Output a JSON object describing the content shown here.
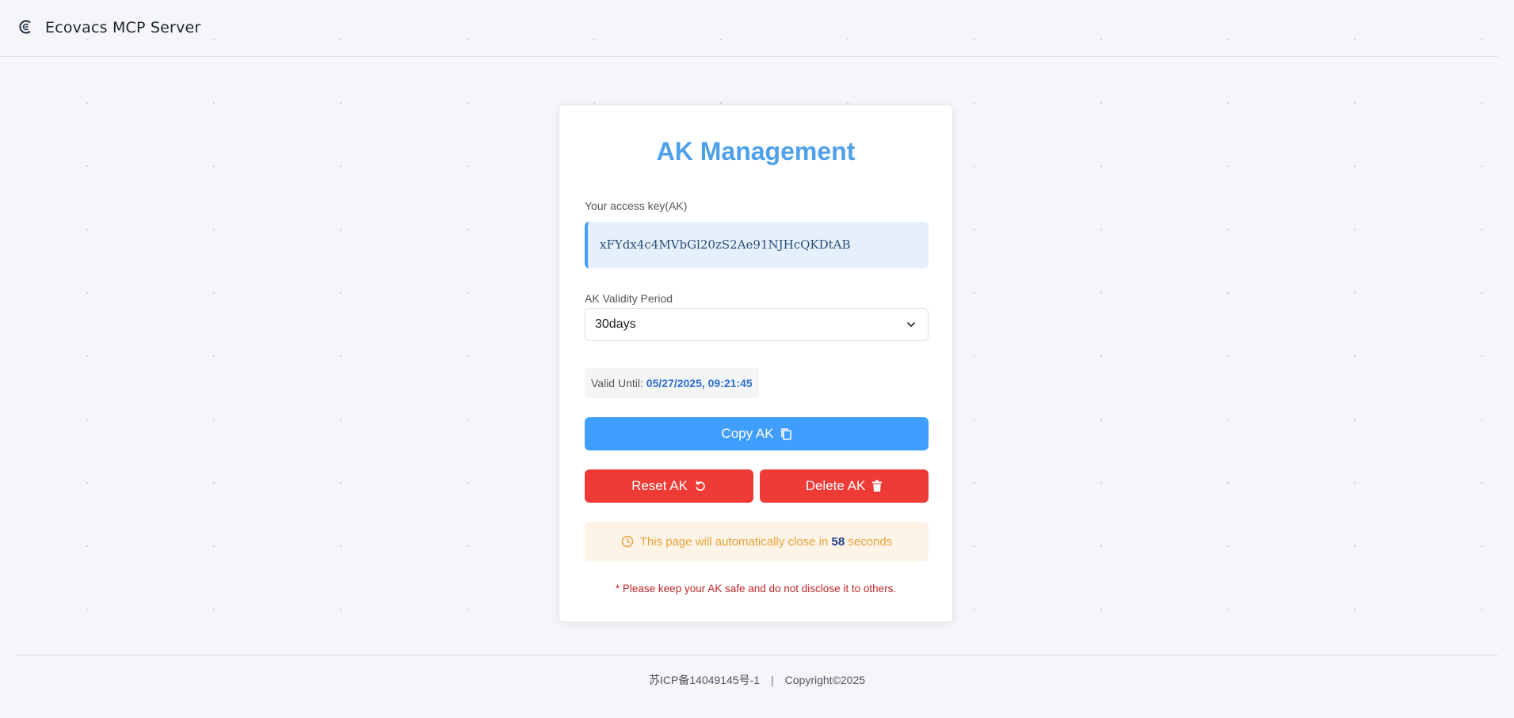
{
  "header": {
    "title": "Ecovacs MCP Server",
    "logo_icon": "ecovacs-logo-icon"
  },
  "card": {
    "title": "AK Management",
    "ak_label": "Your access key(AK)",
    "ak_value": "xFYdx4c4MVbGl20zS2Ae91NJHcQKDtAB",
    "validity_label": "AK Validity Period",
    "validity_selected": "30days",
    "valid_until_label": "Valid Until:",
    "valid_until_value": "05/27/2025, 09:21:45",
    "copy_button": "Copy AK",
    "reset_button": "Reset AK",
    "delete_button": "Delete AK",
    "notice_prefix": "This page will automatically close in",
    "notice_count": "58",
    "notice_suffix": "seconds",
    "warning": "* Please keep your AK safe and do not disclose it to others."
  },
  "footer": {
    "icp": "苏ICP备14049145号-1",
    "separator": "|",
    "copyright": "Copyright©2025"
  },
  "colors": {
    "primary": "#409eff",
    "danger": "#ef3b36",
    "title": "#4ea0ea",
    "warning_text": "#e6a23c"
  }
}
